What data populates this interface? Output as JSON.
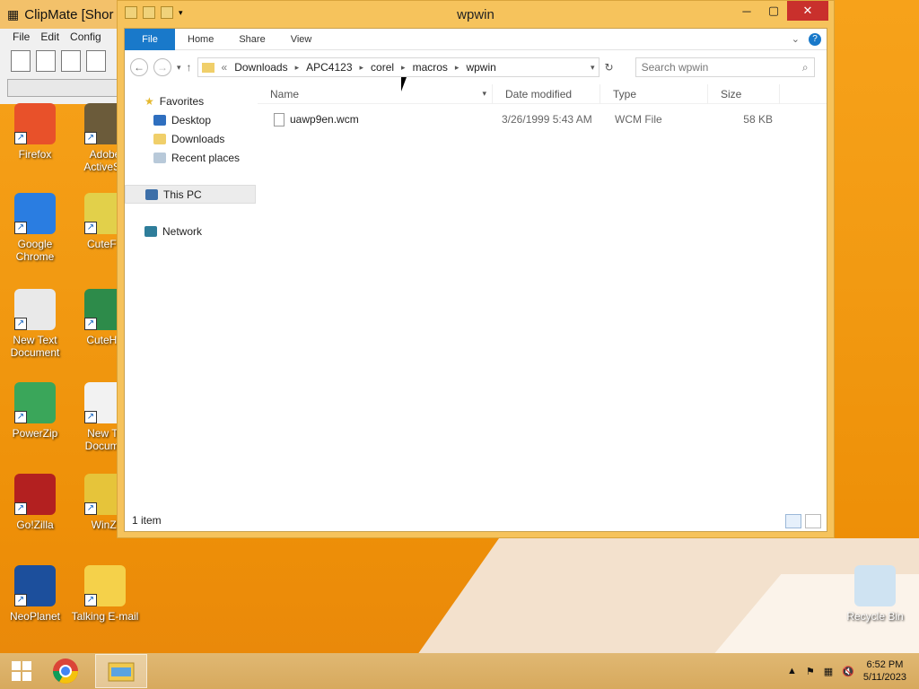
{
  "clipmate": {
    "title": "ClipMate [Shor",
    "menu": [
      "File",
      "Edit",
      "Config"
    ]
  },
  "desktop_icons": [
    {
      "id": "firefox",
      "label": "Firefox",
      "icon": "firefox-icon",
      "color": "#e8512a"
    },
    {
      "id": "adobe",
      "label": "Adobe ActiveSh",
      "icon": "adobe-activeshare-icon",
      "color": "#6b5b3a"
    },
    {
      "id": "chrome",
      "label": "Google Chrome",
      "icon": "chrome-icon",
      "color": "#2a7de1"
    },
    {
      "id": "cuteftp",
      "label": "CuteFT",
      "icon": "cuteftp-icon",
      "color": "#e2d04a"
    },
    {
      "id": "newtext",
      "label": "New Text Document",
      "icon": "settings-document-icon",
      "color": "#e9e9e9"
    },
    {
      "id": "cutehtml",
      "label": "CuteHT",
      "icon": "cutehtml-icon",
      "color": "#2d8b4a"
    },
    {
      "id": "powerzip",
      "label": "PowerZip",
      "icon": "powerzip-icon",
      "color": "#3aa65a"
    },
    {
      "id": "newtext2",
      "label": "New Te Docume",
      "icon": "text-document-icon",
      "color": "#f2f2f2"
    },
    {
      "id": "gozilla",
      "label": "Go!Zilla",
      "icon": "gozilla-icon",
      "color": "#b32020"
    },
    {
      "id": "winzip",
      "label": "WinZi",
      "icon": "winzip-icon",
      "color": "#e6c43a"
    },
    {
      "id": "neoplanet",
      "label": "NeoPlanet",
      "icon": "neoplanet-icon",
      "color": "#1c4f9c"
    },
    {
      "id": "talking",
      "label": "Talking E-mail",
      "icon": "talking-email-icon",
      "color": "#f5d14a"
    },
    {
      "id": "recycle",
      "label": "Recycle Bin",
      "icon": "recycle-bin-icon",
      "color": "#cfe3f2"
    }
  ],
  "explorer": {
    "title": "wpwin",
    "ribbon": {
      "file": "File",
      "tabs": [
        "Home",
        "Share",
        "View"
      ]
    },
    "breadcrumb": {
      "lead": "«",
      "parts": [
        "Downloads",
        "APC4123",
        "corel",
        "macros",
        "wpwin"
      ]
    },
    "search_placeholder": "Search wpwin",
    "nav": {
      "favorites": "Favorites",
      "fav_items": [
        "Desktop",
        "Downloads",
        "Recent places"
      ],
      "this_pc": "This PC",
      "network": "Network"
    },
    "columns": [
      "Name",
      "Date modified",
      "Type",
      "Size"
    ],
    "files": [
      {
        "name": "uawp9en.wcm",
        "date": "3/26/1999 5:43 AM",
        "type": "WCM File",
        "size": "58 KB"
      }
    ],
    "status": "1 item"
  },
  "taskbar": {
    "time": "6:52 PM",
    "date": "5/11/2023"
  }
}
